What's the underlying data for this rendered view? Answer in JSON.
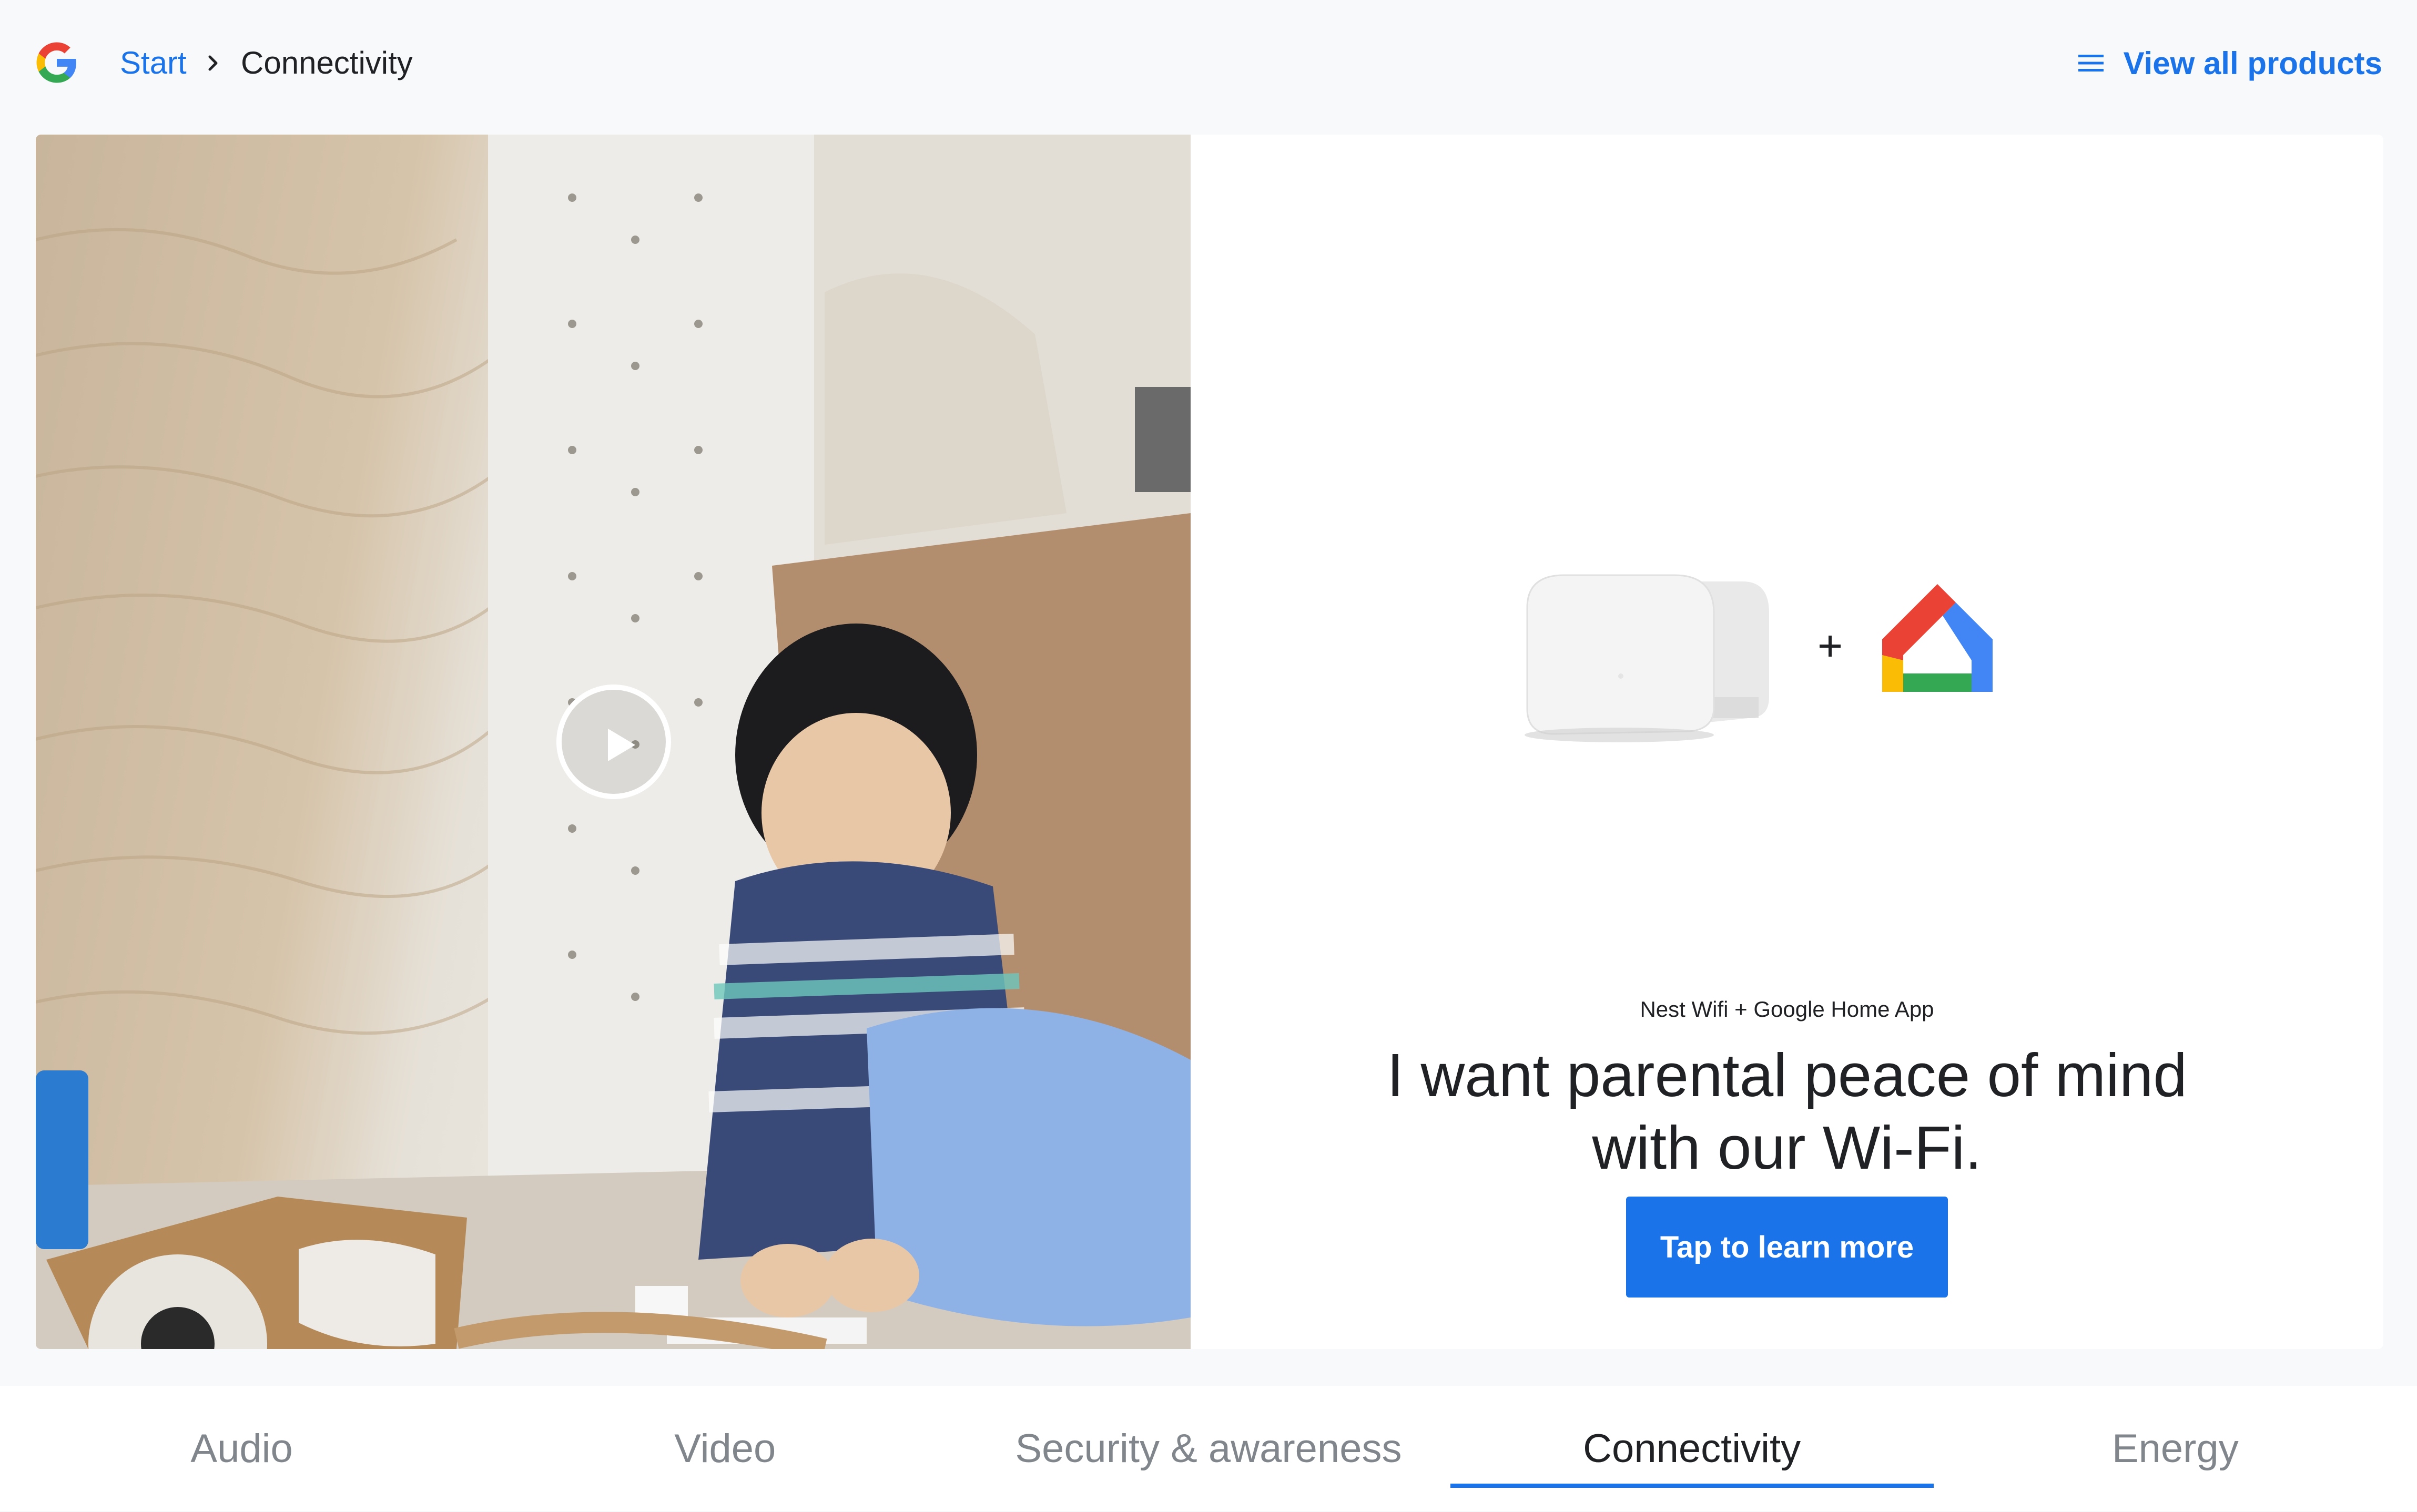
{
  "header": {
    "logo_icon": "google-g-logo",
    "breadcrumb": {
      "start_label": "Start",
      "separator_icon": "chevron-right-icon",
      "current_label": "Connectivity"
    },
    "view_all": {
      "icon": "menu-icon",
      "label": "View all products"
    }
  },
  "hero": {
    "photo": {
      "description_icon": "video-thumbnail",
      "play_icon": "play-icon"
    },
    "info": {
      "product_images": [
        "nest-wifi-device",
        "google-home-app-icon"
      ],
      "plus_sign": "+",
      "product_name": "Nest Wifi + Google Home App",
      "headline_line1": "I want parental peace of mind",
      "headline_line2": "with our Wi-Fi.",
      "cta_label": "Tap to learn more"
    }
  },
  "tabs": {
    "items": [
      {
        "label": "Audio",
        "active": false
      },
      {
        "label": "Video",
        "active": false
      },
      {
        "label": "Security & awareness",
        "active": false
      },
      {
        "label": "Connectivity",
        "active": true
      },
      {
        "label": "Energy",
        "active": false
      }
    ]
  },
  "colors": {
    "accent": "#1a73e8",
    "page_background": "#f8f9fa",
    "text_primary": "#202124",
    "text_inactive": "#80868b"
  }
}
